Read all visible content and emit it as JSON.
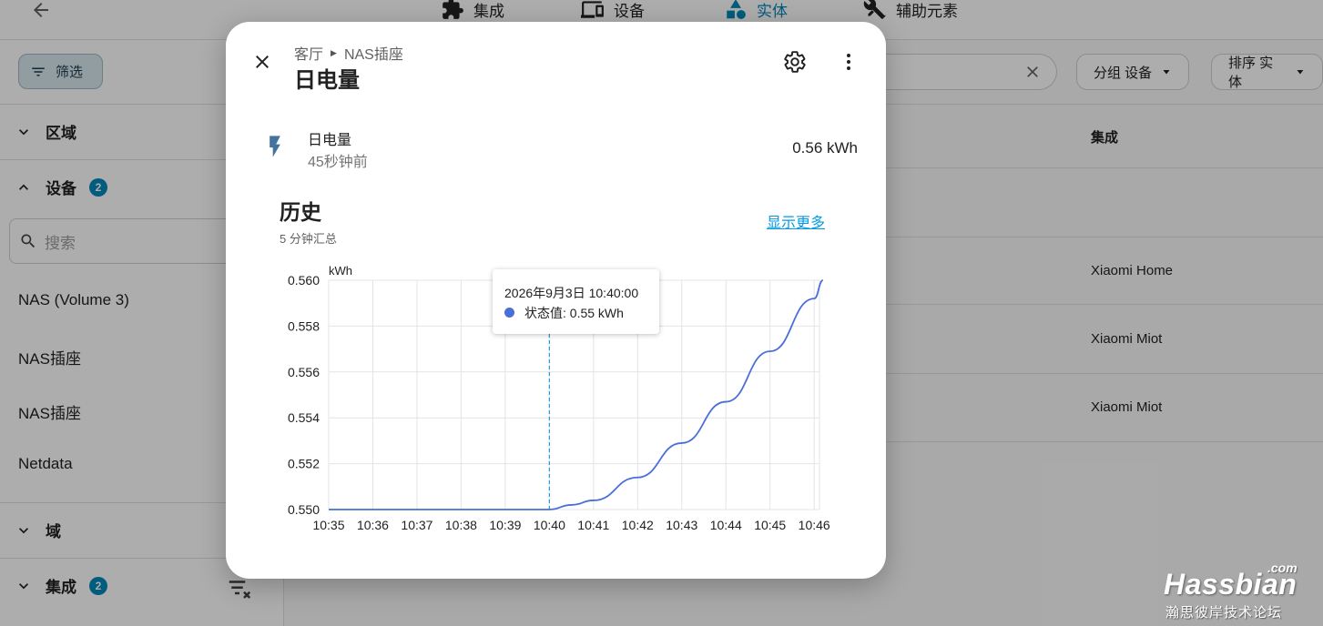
{
  "app": {
    "tabs": [
      {
        "label": "集成",
        "icon": "puzzle-icon"
      },
      {
        "label": "设备",
        "icon": "devices-icon"
      },
      {
        "label": "实体",
        "icon": "shapes-icon"
      },
      {
        "label": "辅助元素",
        "icon": "tools-icon"
      }
    ],
    "sidebar": {
      "filter_label": "筛选",
      "sections": {
        "area": "区域",
        "devices": "设备",
        "devices_count": "2",
        "domain": "域",
        "integrations": "集成",
        "integrations_count": "2"
      },
      "search_placeholder": "搜索",
      "device_items": [
        "NAS (Volume 3)",
        "NAS插座",
        "NAS插座",
        "Netdata"
      ]
    },
    "main": {
      "group_by": "分组 设备",
      "sort_by": "排序 实体",
      "column_integration": "集成",
      "integration_cells": [
        "Xiaomi Home",
        "Xiaomi Miot",
        "Xiaomi Miot"
      ]
    }
  },
  "dialog": {
    "breadcrumb_area": "客厅",
    "breadcrumb_device": "NAS插座",
    "title": "日电量",
    "state": {
      "name": "日电量",
      "last_changed": "45秒钟前",
      "value": "0.56 kWh"
    },
    "history": {
      "title": "历史",
      "subtitle": "5 分钟汇总",
      "show_more": "显示更多"
    },
    "tooltip": {
      "date": "2026年9月3日 10:40:00",
      "series_value": "状态值: 0.55 kWh"
    }
  },
  "chart_data": {
    "type": "line",
    "ylabel": "kWh",
    "ylim": [
      0.55,
      0.56
    ],
    "yticks": [
      "0.550",
      "0.552",
      "0.554",
      "0.556",
      "0.558",
      "0.560"
    ],
    "categories": [
      "10:35",
      "10:36",
      "10:37",
      "10:38",
      "10:39",
      "10:40",
      "10:41",
      "10:42",
      "10:43",
      "10:44",
      "10:45",
      "10:46"
    ],
    "grid": true,
    "series": [
      {
        "color": "#4a6fd8",
        "x": [
          "10:35",
          "10:40",
          "10:40.5",
          "10:41",
          "10:42",
          "10:43",
          "10:44",
          "10:45",
          "10:46",
          "10:46.2"
        ],
        "values": [
          0.55,
          0.55,
          0.5502,
          0.5504,
          0.5514,
          0.5529,
          0.5547,
          0.5569,
          0.5592,
          0.56
        ]
      }
    ],
    "crosshair_at": "10:40",
    "crosshair_color": "#1e9be0"
  },
  "watermark": {
    "brand": "Hassbian",
    "com": ".com",
    "subtitle": "瀚思彼岸技术论坛"
  }
}
